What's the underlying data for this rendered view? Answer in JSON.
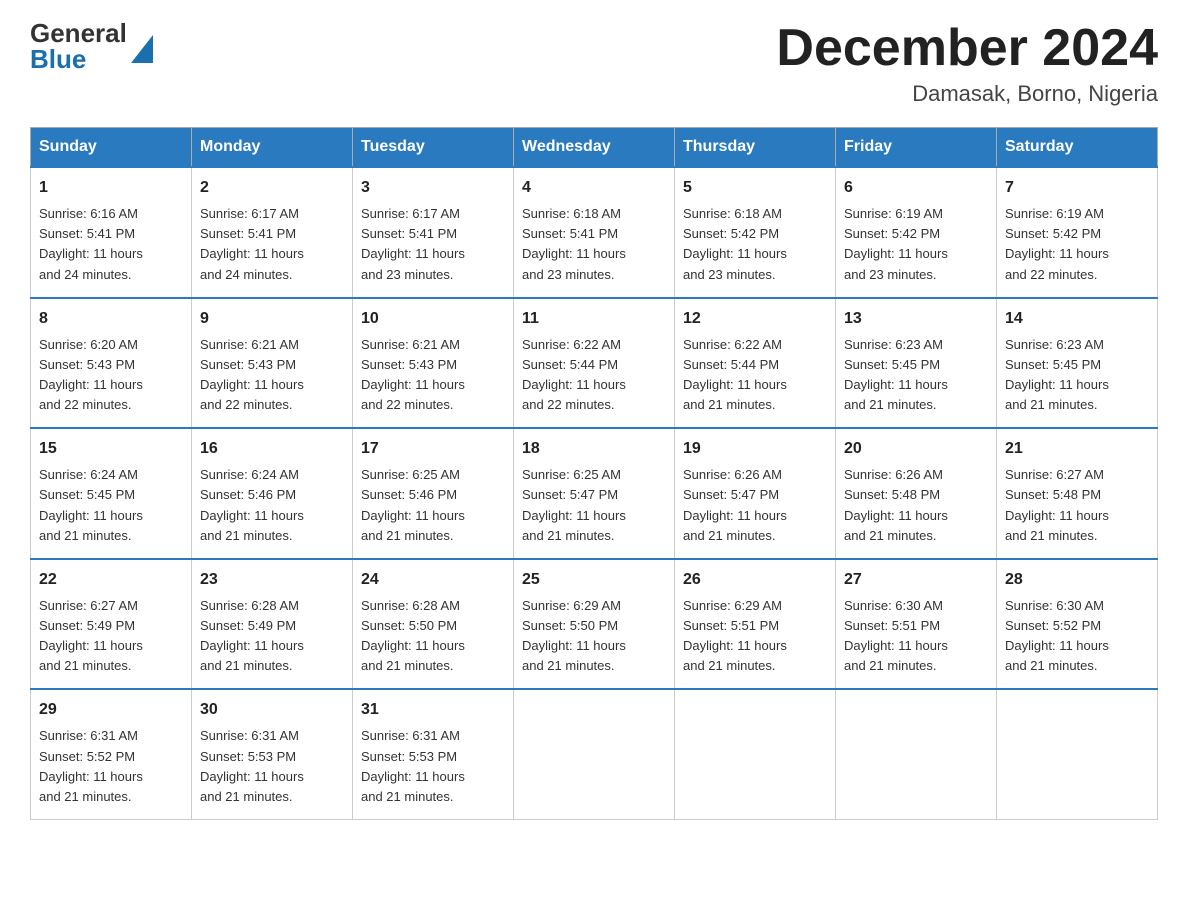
{
  "logo": {
    "general": "General",
    "blue": "Blue"
  },
  "header": {
    "title": "December 2024",
    "subtitle": "Damasak, Borno, Nigeria"
  },
  "days_of_week": [
    "Sunday",
    "Monday",
    "Tuesday",
    "Wednesday",
    "Thursday",
    "Friday",
    "Saturday"
  ],
  "weeks": [
    [
      {
        "day": "1",
        "sunrise": "6:16 AM",
        "sunset": "5:41 PM",
        "daylight": "11 hours and 24 minutes."
      },
      {
        "day": "2",
        "sunrise": "6:17 AM",
        "sunset": "5:41 PM",
        "daylight": "11 hours and 24 minutes."
      },
      {
        "day": "3",
        "sunrise": "6:17 AM",
        "sunset": "5:41 PM",
        "daylight": "11 hours and 23 minutes."
      },
      {
        "day": "4",
        "sunrise": "6:18 AM",
        "sunset": "5:41 PM",
        "daylight": "11 hours and 23 minutes."
      },
      {
        "day": "5",
        "sunrise": "6:18 AM",
        "sunset": "5:42 PM",
        "daylight": "11 hours and 23 minutes."
      },
      {
        "day": "6",
        "sunrise": "6:19 AM",
        "sunset": "5:42 PM",
        "daylight": "11 hours and 23 minutes."
      },
      {
        "day": "7",
        "sunrise": "6:19 AM",
        "sunset": "5:42 PM",
        "daylight": "11 hours and 22 minutes."
      }
    ],
    [
      {
        "day": "8",
        "sunrise": "6:20 AM",
        "sunset": "5:43 PM",
        "daylight": "11 hours and 22 minutes."
      },
      {
        "day": "9",
        "sunrise": "6:21 AM",
        "sunset": "5:43 PM",
        "daylight": "11 hours and 22 minutes."
      },
      {
        "day": "10",
        "sunrise": "6:21 AM",
        "sunset": "5:43 PM",
        "daylight": "11 hours and 22 minutes."
      },
      {
        "day": "11",
        "sunrise": "6:22 AM",
        "sunset": "5:44 PM",
        "daylight": "11 hours and 22 minutes."
      },
      {
        "day": "12",
        "sunrise": "6:22 AM",
        "sunset": "5:44 PM",
        "daylight": "11 hours and 21 minutes."
      },
      {
        "day": "13",
        "sunrise": "6:23 AM",
        "sunset": "5:45 PM",
        "daylight": "11 hours and 21 minutes."
      },
      {
        "day": "14",
        "sunrise": "6:23 AM",
        "sunset": "5:45 PM",
        "daylight": "11 hours and 21 minutes."
      }
    ],
    [
      {
        "day": "15",
        "sunrise": "6:24 AM",
        "sunset": "5:45 PM",
        "daylight": "11 hours and 21 minutes."
      },
      {
        "day": "16",
        "sunrise": "6:24 AM",
        "sunset": "5:46 PM",
        "daylight": "11 hours and 21 minutes."
      },
      {
        "day": "17",
        "sunrise": "6:25 AM",
        "sunset": "5:46 PM",
        "daylight": "11 hours and 21 minutes."
      },
      {
        "day": "18",
        "sunrise": "6:25 AM",
        "sunset": "5:47 PM",
        "daylight": "11 hours and 21 minutes."
      },
      {
        "day": "19",
        "sunrise": "6:26 AM",
        "sunset": "5:47 PM",
        "daylight": "11 hours and 21 minutes."
      },
      {
        "day": "20",
        "sunrise": "6:26 AM",
        "sunset": "5:48 PM",
        "daylight": "11 hours and 21 minutes."
      },
      {
        "day": "21",
        "sunrise": "6:27 AM",
        "sunset": "5:48 PM",
        "daylight": "11 hours and 21 minutes."
      }
    ],
    [
      {
        "day": "22",
        "sunrise": "6:27 AM",
        "sunset": "5:49 PM",
        "daylight": "11 hours and 21 minutes."
      },
      {
        "day": "23",
        "sunrise": "6:28 AM",
        "sunset": "5:49 PM",
        "daylight": "11 hours and 21 minutes."
      },
      {
        "day": "24",
        "sunrise": "6:28 AM",
        "sunset": "5:50 PM",
        "daylight": "11 hours and 21 minutes."
      },
      {
        "day": "25",
        "sunrise": "6:29 AM",
        "sunset": "5:50 PM",
        "daylight": "11 hours and 21 minutes."
      },
      {
        "day": "26",
        "sunrise": "6:29 AM",
        "sunset": "5:51 PM",
        "daylight": "11 hours and 21 minutes."
      },
      {
        "day": "27",
        "sunrise": "6:30 AM",
        "sunset": "5:51 PM",
        "daylight": "11 hours and 21 minutes."
      },
      {
        "day": "28",
        "sunrise": "6:30 AM",
        "sunset": "5:52 PM",
        "daylight": "11 hours and 21 minutes."
      }
    ],
    [
      {
        "day": "29",
        "sunrise": "6:31 AM",
        "sunset": "5:52 PM",
        "daylight": "11 hours and 21 minutes."
      },
      {
        "day": "30",
        "sunrise": "6:31 AM",
        "sunset": "5:53 PM",
        "daylight": "11 hours and 21 minutes."
      },
      {
        "day": "31",
        "sunrise": "6:31 AM",
        "sunset": "5:53 PM",
        "daylight": "11 hours and 21 minutes."
      },
      null,
      null,
      null,
      null
    ]
  ],
  "labels": {
    "sunrise": "Sunrise:",
    "sunset": "Sunset:",
    "daylight": "Daylight:"
  }
}
